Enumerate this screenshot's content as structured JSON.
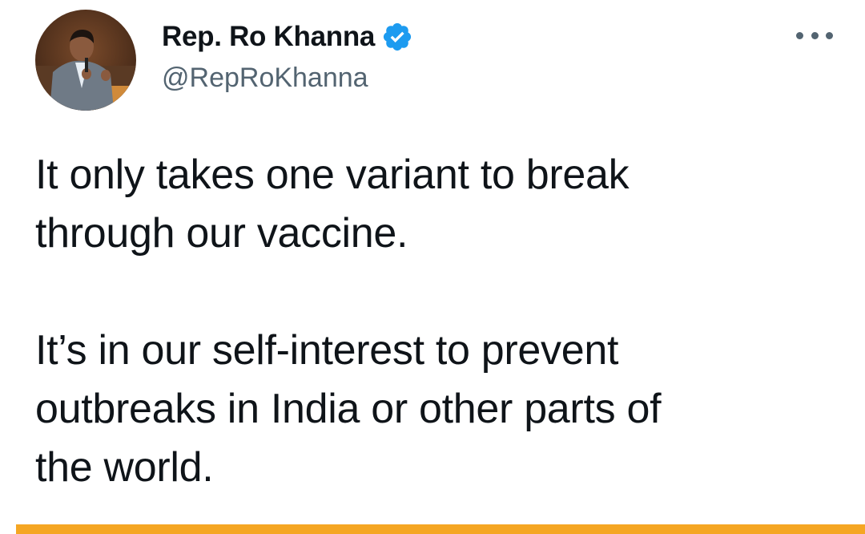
{
  "tweet": {
    "author": {
      "display_name": "Rep. Ro Khanna",
      "handle": "@RepRoKhanna",
      "verified": true,
      "avatar_icon": "profile-photo"
    },
    "more_icon": "more-horizontal-icon",
    "paragraphs": [
      [
        "It only takes one variant to break",
        "through our vaccine."
      ],
      [
        "It’s in our self-interest to prevent",
        "outbreaks in India or other parts of",
        "the world."
      ]
    ]
  },
  "colors": {
    "verified_badge": "#1d9bf0",
    "text_primary": "#0f1419",
    "text_secondary": "#536471",
    "accent_bar": "#f5a623"
  }
}
